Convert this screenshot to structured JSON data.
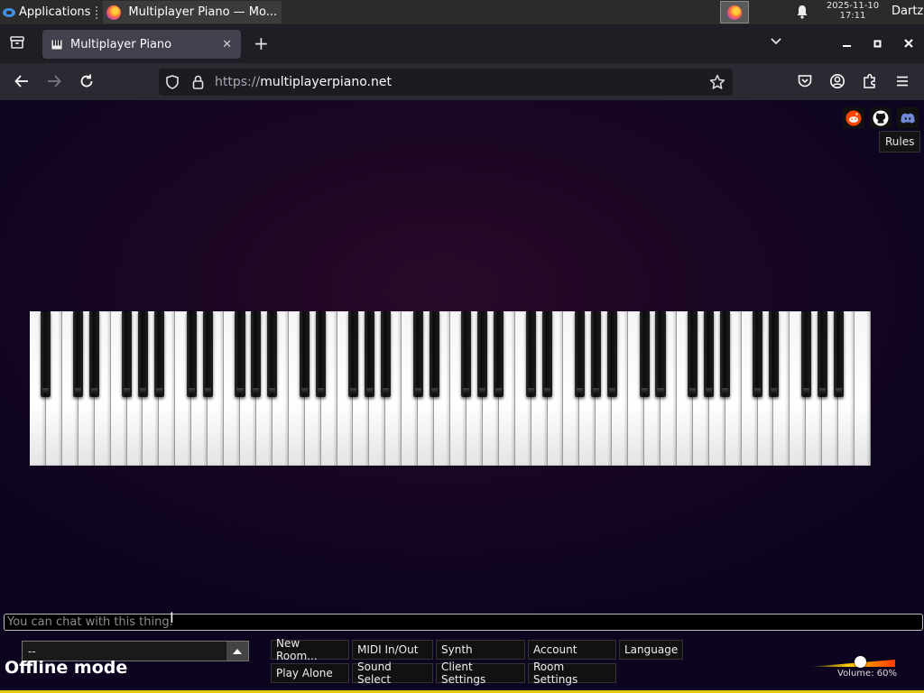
{
  "taskbar": {
    "apps_label": "Applications",
    "window_title": "Multiplayer Piano — Mo...",
    "clock_date": "2025-11-10",
    "clock_time": "17:11",
    "user": "Dartz"
  },
  "browser": {
    "tab_title": "Multiplayer Piano",
    "url_protocol": "https://",
    "url_host": "multiplayerpiano.net"
  },
  "page": {
    "tooltip": "Rules",
    "chat_placeholder": "You can chat with this thing.",
    "room_value": "--",
    "status": "Offline mode",
    "buttons_row1": [
      "New Room...",
      "MIDI In/Out",
      "Synth",
      "Account",
      "Language"
    ],
    "buttons_row2": [
      "Play Alone",
      "Sound Select",
      "Client Settings",
      "Room Settings"
    ],
    "volume_label": "Volume: 60%",
    "volume_level": 0.6
  },
  "colors": {
    "page_bg_dark": "#0d0520",
    "page_bg_glow": "#2a0a2a",
    "tab_active": "#42414d",
    "navbar": "#2b2a33",
    "accent_strip": "#e6c800"
  },
  "icons": [
    "xfce-menu-icon",
    "firefox-icon",
    "bell-icon",
    "tab-overview-icon",
    "piano-icon",
    "close-icon",
    "plus-icon",
    "chevron-down-icon",
    "minimize-icon",
    "maximize-icon",
    "back-arrow-icon",
    "forward-arrow-icon",
    "reload-icon",
    "shield-icon",
    "lock-icon",
    "star-icon",
    "pocket-icon",
    "account-icon",
    "extensions-icon",
    "menu-icon",
    "reddit-icon",
    "github-icon",
    "discord-icon"
  ]
}
